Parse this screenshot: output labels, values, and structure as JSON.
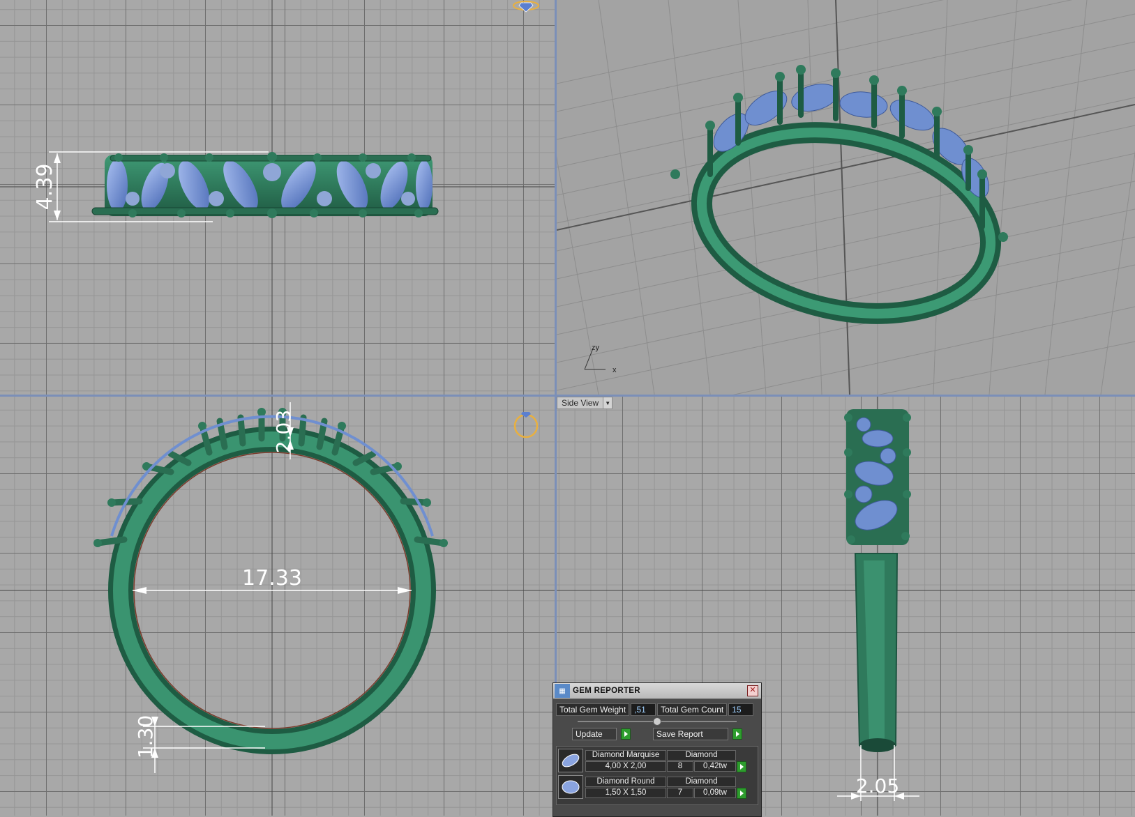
{
  "viewports": {
    "top": {
      "dimension_height": "4.39"
    },
    "perspective": {
      "axis_labels": [
        "zy",
        "x"
      ]
    },
    "front": {
      "dimension_inner_diameter": "17.33",
      "dimension_top_thickness": "2.03",
      "dimension_bottom_thickness": "1.30"
    },
    "side": {
      "view_label": "Side View",
      "dimension_width": "2.05"
    }
  },
  "gem_reporter": {
    "title": "GEM REPORTER",
    "total_weight_label": "Total Gem Weight",
    "total_weight_value": ",51",
    "total_count_label": "Total Gem Count",
    "total_count_value": "15",
    "update_label": "Update",
    "save_report_label": "Save Report",
    "gems": [
      {
        "name": "Diamond Marquise",
        "size": "4,00 X 2,00",
        "material": "Diamond",
        "count": "8",
        "weight": "0,42tw",
        "icon": "marquise-gem-icon"
      },
      {
        "name": "Diamond Round",
        "size": "1,50 X 1,50",
        "material": "Diamond",
        "count": "7",
        "weight": "0,09tw",
        "icon": "round-gem-icon"
      }
    ]
  },
  "colors": {
    "metal": "#2f7a5c",
    "gem": "#6f8fd0",
    "grid_major": "#6e6e6e",
    "viewport_border": "#7b8fb8"
  }
}
